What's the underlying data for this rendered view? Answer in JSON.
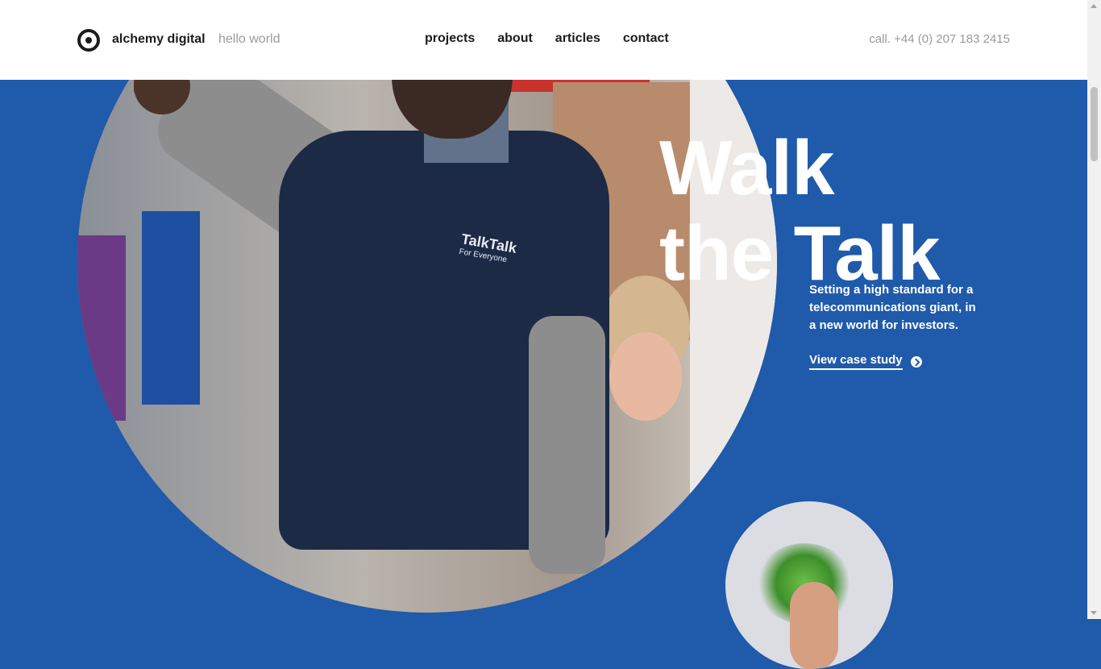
{
  "header": {
    "brand": "alchemy digital",
    "tagline": "hello world",
    "nav": [
      "projects",
      "about",
      "articles",
      "contact"
    ],
    "phone": "call. +44 (0) 207 183 2415"
  },
  "hero": {
    "title_line1": "Walk",
    "title_line2": "the Talk",
    "description": "Setting a high standard for a telecommunications giant, in a new world for investors.",
    "cta": "View case study",
    "photo_logo": "TalkTalk",
    "photo_logo_sub": "For Everyone"
  },
  "colors": {
    "background": "#1f5aab",
    "header": "#ffffff",
    "text_dark": "#1c1c1c",
    "text_muted": "#9a9a9a"
  },
  "icons": {
    "logo": "target-logo-icon",
    "cta": "arrow-right-circle-icon",
    "scroll": [
      "scroll-up-icon",
      "scroll-down-icon"
    ]
  }
}
